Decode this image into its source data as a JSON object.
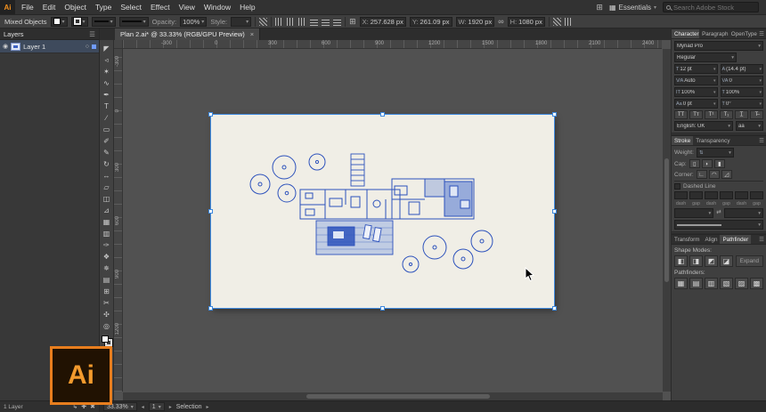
{
  "app": {
    "logo": "Ai",
    "badge": "Ai"
  },
  "menu_bar": {
    "items": [
      "File",
      "Edit",
      "Object",
      "Type",
      "Select",
      "Effect",
      "View",
      "Window",
      "Help"
    ],
    "workspace": "Essentials",
    "search_placeholder": "Search Adobe Stock"
  },
  "control_bar": {
    "selection_type": "Mixed Objects",
    "opacity_label": "Opacity:",
    "opacity_value": "100%",
    "style_label": "Style:",
    "x_label": "X:",
    "x_value": "257.628 px",
    "y_label": "Y:",
    "y_value": "261.09 px",
    "w_label": "W:",
    "w_value": "1920 px",
    "h_label": "H:",
    "h_value": "1080 px"
  },
  "document_tab": {
    "title": "Plan 2.ai* @ 33.33% (RGB/GPU Preview)",
    "close": "×"
  },
  "layers_panel": {
    "title": "Layers",
    "rows": [
      {
        "name": "Layer 1"
      }
    ],
    "footer": "1 Layer"
  },
  "toolbar": {
    "tools": [
      {
        "name": "selection",
        "glyph": "◤"
      },
      {
        "name": "direct-selection",
        "glyph": "◃"
      },
      {
        "name": "magic-wand",
        "glyph": "✶"
      },
      {
        "name": "lasso",
        "glyph": "∿"
      },
      {
        "name": "pen",
        "glyph": "✒"
      },
      {
        "name": "type",
        "glyph": "T"
      },
      {
        "name": "line-segment",
        "glyph": "∕"
      },
      {
        "name": "rectangle",
        "glyph": "▭"
      },
      {
        "name": "paintbrush",
        "glyph": "✐"
      },
      {
        "name": "pencil",
        "glyph": "✎"
      },
      {
        "name": "rotate",
        "glyph": "↻"
      },
      {
        "name": "width",
        "glyph": "↔"
      },
      {
        "name": "free-transform",
        "glyph": "▱"
      },
      {
        "name": "shape-builder",
        "glyph": "◫"
      },
      {
        "name": "perspective-grid",
        "glyph": "⊿"
      },
      {
        "name": "mesh",
        "glyph": "▦"
      },
      {
        "name": "gradient",
        "glyph": "▥"
      },
      {
        "name": "eyedropper",
        "glyph": "✑"
      },
      {
        "name": "blend",
        "glyph": "❖"
      },
      {
        "name": "symbol-sprayer",
        "glyph": "✵"
      },
      {
        "name": "column-graph",
        "glyph": "▤"
      },
      {
        "name": "artboard",
        "glyph": "⊞"
      },
      {
        "name": "slice",
        "glyph": "✂"
      },
      {
        "name": "hand",
        "glyph": "✣"
      },
      {
        "name": "zoom",
        "glyph": "◎"
      }
    ]
  },
  "rulers": {
    "top": [
      "-300",
      "0",
      "300",
      "600",
      "900",
      "1200",
      "1500",
      "1800",
      "2100",
      "2400"
    ],
    "left": [
      "-300",
      "0",
      "300",
      "600",
      "900",
      "1200"
    ]
  },
  "character_panel": {
    "tabs": [
      "Character",
      "Paragraph",
      "OpenType"
    ],
    "active_tab": "Character",
    "font_family": "Myriad Pro",
    "font_style": "Regular",
    "rows": [
      {
        "icon": "T",
        "name": "font-size",
        "value": "12 pt"
      },
      {
        "icon": "A",
        "name": "leading",
        "value": "(14.4 pt)"
      },
      {
        "icon": "V⁄A",
        "name": "kerning",
        "value": "Auto"
      },
      {
        "icon": "VA",
        "name": "tracking",
        "value": "0"
      },
      {
        "icon": "IT",
        "name": "vertical-scale",
        "value": "100%"
      },
      {
        "icon": "T",
        "name": "horizontal-scale",
        "value": "100%"
      },
      {
        "icon": "Aa",
        "name": "baseline-shift",
        "value": "0 pt"
      },
      {
        "icon": "T",
        "name": "character-rotation",
        "value": "0°"
      }
    ],
    "style_buttons": [
      {
        "name": "all-caps",
        "glyph": "TT"
      },
      {
        "name": "small-caps",
        "glyph": "Tᴛ"
      },
      {
        "name": "superscript",
        "glyph": "T¹"
      },
      {
        "name": "subscript",
        "glyph": "T₁"
      },
      {
        "name": "underline",
        "glyph": "T̲"
      },
      {
        "name": "strikethrough",
        "glyph": "T̶"
      }
    ],
    "language": "English: UK",
    "anti_alias": "aa"
  },
  "stroke_panel": {
    "tabs": [
      "Stroke",
      "Transparency"
    ],
    "active_tab": "Stroke",
    "weight_label": "Weight:",
    "cap_label": "Cap:",
    "corner_label": "Corner:",
    "dashed_line_label": "Dashed Line",
    "dash_gap_labels": [
      "dash",
      "gap",
      "dash",
      "gap",
      "dash",
      "gap"
    ],
    "cap_icons": [
      {
        "name": "butt-cap",
        "glyph": "▯"
      },
      {
        "name": "round-cap",
        "glyph": "◗"
      },
      {
        "name": "projecting-cap",
        "glyph": "▮"
      }
    ],
    "corner_icons": [
      {
        "name": "miter-join",
        "glyph": "∟"
      },
      {
        "name": "round-join",
        "glyph": "◠"
      },
      {
        "name": "bevel-join",
        "glyph": "◿"
      }
    ]
  },
  "pathfinder_panel": {
    "tabs": [
      "Transform",
      "Align",
      "Pathfinder"
    ],
    "active_tab": "Pathfinder",
    "shape_modes_label": "Shape Modes:",
    "shape_modes": [
      {
        "name": "unite",
        "glyph": "◧"
      },
      {
        "name": "minus-front",
        "glyph": "◨"
      },
      {
        "name": "intersect",
        "glyph": "◩"
      },
      {
        "name": "exclude",
        "glyph": "◪"
      }
    ],
    "expand_button": "Expand",
    "pathfinders_label": "Pathfinders:",
    "pathfinders": [
      {
        "name": "divide",
        "glyph": "▦"
      },
      {
        "name": "trim",
        "glyph": "▤"
      },
      {
        "name": "merge",
        "glyph": "▥"
      },
      {
        "name": "crop",
        "glyph": "▧"
      },
      {
        "name": "outline",
        "glyph": "▨"
      },
      {
        "name": "minus-back",
        "glyph": "▩"
      }
    ]
  },
  "status_bar": {
    "zoom": "33.33%",
    "artboard_nav": "1",
    "tool_label": "Selection"
  },
  "colors": {
    "plan_blue": "#2d52bc",
    "selection_blue": "#3f8ae0",
    "badge_orange": "#e87e1e",
    "artboard_bg": "#f0eee6"
  }
}
